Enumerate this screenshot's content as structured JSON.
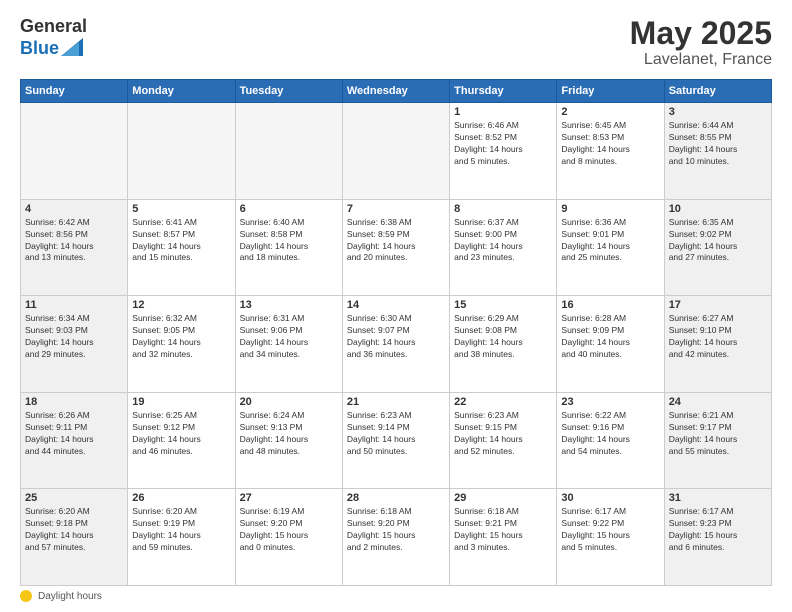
{
  "logo": {
    "general": "General",
    "blue": "Blue"
  },
  "header": {
    "month": "May 2025",
    "location": "Lavelanet, France"
  },
  "days_of_week": [
    "Sunday",
    "Monday",
    "Tuesday",
    "Wednesday",
    "Thursday",
    "Friday",
    "Saturday"
  ],
  "weeks": [
    [
      {
        "day": "",
        "info": "",
        "empty": true
      },
      {
        "day": "",
        "info": "",
        "empty": true
      },
      {
        "day": "",
        "info": "",
        "empty": true
      },
      {
        "day": "",
        "info": "",
        "empty": true
      },
      {
        "day": "1",
        "info": "Sunrise: 6:46 AM\nSunset: 8:52 PM\nDaylight: 14 hours\nand 5 minutes."
      },
      {
        "day": "2",
        "info": "Sunrise: 6:45 AM\nSunset: 8:53 PM\nDaylight: 14 hours\nand 8 minutes."
      },
      {
        "day": "3",
        "info": "Sunrise: 6:44 AM\nSunset: 8:55 PM\nDaylight: 14 hours\nand 10 minutes."
      }
    ],
    [
      {
        "day": "4",
        "info": "Sunrise: 6:42 AM\nSunset: 8:56 PM\nDaylight: 14 hours\nand 13 minutes."
      },
      {
        "day": "5",
        "info": "Sunrise: 6:41 AM\nSunset: 8:57 PM\nDaylight: 14 hours\nand 15 minutes."
      },
      {
        "day": "6",
        "info": "Sunrise: 6:40 AM\nSunset: 8:58 PM\nDaylight: 14 hours\nand 18 minutes."
      },
      {
        "day": "7",
        "info": "Sunrise: 6:38 AM\nSunset: 8:59 PM\nDaylight: 14 hours\nand 20 minutes."
      },
      {
        "day": "8",
        "info": "Sunrise: 6:37 AM\nSunset: 9:00 PM\nDaylight: 14 hours\nand 23 minutes."
      },
      {
        "day": "9",
        "info": "Sunrise: 6:36 AM\nSunset: 9:01 PM\nDaylight: 14 hours\nand 25 minutes."
      },
      {
        "day": "10",
        "info": "Sunrise: 6:35 AM\nSunset: 9:02 PM\nDaylight: 14 hours\nand 27 minutes."
      }
    ],
    [
      {
        "day": "11",
        "info": "Sunrise: 6:34 AM\nSunset: 9:03 PM\nDaylight: 14 hours\nand 29 minutes."
      },
      {
        "day": "12",
        "info": "Sunrise: 6:32 AM\nSunset: 9:05 PM\nDaylight: 14 hours\nand 32 minutes."
      },
      {
        "day": "13",
        "info": "Sunrise: 6:31 AM\nSunset: 9:06 PM\nDaylight: 14 hours\nand 34 minutes."
      },
      {
        "day": "14",
        "info": "Sunrise: 6:30 AM\nSunset: 9:07 PM\nDaylight: 14 hours\nand 36 minutes."
      },
      {
        "day": "15",
        "info": "Sunrise: 6:29 AM\nSunset: 9:08 PM\nDaylight: 14 hours\nand 38 minutes."
      },
      {
        "day": "16",
        "info": "Sunrise: 6:28 AM\nSunset: 9:09 PM\nDaylight: 14 hours\nand 40 minutes."
      },
      {
        "day": "17",
        "info": "Sunrise: 6:27 AM\nSunset: 9:10 PM\nDaylight: 14 hours\nand 42 minutes."
      }
    ],
    [
      {
        "day": "18",
        "info": "Sunrise: 6:26 AM\nSunset: 9:11 PM\nDaylight: 14 hours\nand 44 minutes."
      },
      {
        "day": "19",
        "info": "Sunrise: 6:25 AM\nSunset: 9:12 PM\nDaylight: 14 hours\nand 46 minutes."
      },
      {
        "day": "20",
        "info": "Sunrise: 6:24 AM\nSunset: 9:13 PM\nDaylight: 14 hours\nand 48 minutes."
      },
      {
        "day": "21",
        "info": "Sunrise: 6:23 AM\nSunset: 9:14 PM\nDaylight: 14 hours\nand 50 minutes."
      },
      {
        "day": "22",
        "info": "Sunrise: 6:23 AM\nSunset: 9:15 PM\nDaylight: 14 hours\nand 52 minutes."
      },
      {
        "day": "23",
        "info": "Sunrise: 6:22 AM\nSunset: 9:16 PM\nDaylight: 14 hours\nand 54 minutes."
      },
      {
        "day": "24",
        "info": "Sunrise: 6:21 AM\nSunset: 9:17 PM\nDaylight: 14 hours\nand 55 minutes."
      }
    ],
    [
      {
        "day": "25",
        "info": "Sunrise: 6:20 AM\nSunset: 9:18 PM\nDaylight: 14 hours\nand 57 minutes."
      },
      {
        "day": "26",
        "info": "Sunrise: 6:20 AM\nSunset: 9:19 PM\nDaylight: 14 hours\nand 59 minutes."
      },
      {
        "day": "27",
        "info": "Sunrise: 6:19 AM\nSunset: 9:20 PM\nDaylight: 15 hours\nand 0 minutes."
      },
      {
        "day": "28",
        "info": "Sunrise: 6:18 AM\nSunset: 9:20 PM\nDaylight: 15 hours\nand 2 minutes."
      },
      {
        "day": "29",
        "info": "Sunrise: 6:18 AM\nSunset: 9:21 PM\nDaylight: 15 hours\nand 3 minutes."
      },
      {
        "day": "30",
        "info": "Sunrise: 6:17 AM\nSunset: 9:22 PM\nDaylight: 15 hours\nand 5 minutes."
      },
      {
        "day": "31",
        "info": "Sunrise: 6:17 AM\nSunset: 9:23 PM\nDaylight: 15 hours\nand 6 minutes."
      }
    ]
  ],
  "footer": {
    "daylight_label": "Daylight hours"
  }
}
